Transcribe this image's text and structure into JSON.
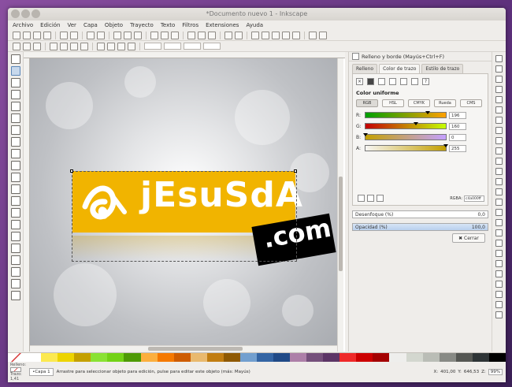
{
  "window": {
    "title": "*Documento nuevo 1 - Inkscape"
  },
  "menu": [
    "Archivo",
    "Edición",
    "Ver",
    "Capa",
    "Objeto",
    "Trayecto",
    "Texto",
    "Filtros",
    "Extensiones",
    "Ayuda"
  ],
  "canvas": {
    "logo_text": "jEsuSdA",
    "com_text": ".com"
  },
  "fill_stroke": {
    "title": "Relleno y borde (Mayús+Ctrl+F)",
    "tabs": [
      "Relleno",
      "Color de trazo",
      "Estilo de trazo"
    ],
    "active_tab": 1,
    "paint_label": "Color uniforme",
    "modes": [
      "RGB",
      "HSL",
      "CMYK",
      "Rueda",
      "CMS"
    ],
    "active_mode": 0,
    "channels": [
      {
        "label": "R:",
        "value": "196",
        "knob": 0.77,
        "gradient": "linear-gradient(90deg,#00a000,#ffa000)"
      },
      {
        "label": "G:",
        "value": "160",
        "knob": 0.63,
        "gradient": "linear-gradient(90deg,#c40000,#c4ff00)"
      },
      {
        "label": "B:",
        "value": "0",
        "knob": 0.0,
        "gradient": "linear-gradient(90deg,#c4a000,#c4a0ff)"
      },
      {
        "label": "A:",
        "value": "255",
        "knob": 1.0,
        "gradient": "linear-gradient(90deg,rgba(196,160,0,0),#c4a000)"
      }
    ],
    "rgba_label": "RGBA:",
    "rgba_value": "c4a000ff",
    "blur_label": "Desenfoque (%)",
    "blur_value": "0,0",
    "opacity_label": "Opacidad (%)",
    "opacity_value": "100,0",
    "close_label": "Cerrar"
  },
  "palette": [
    "#ffffff",
    "#fce94f",
    "#edd400",
    "#c4a000",
    "#8ae234",
    "#73d216",
    "#4e9a06",
    "#fcaf3e",
    "#f57900",
    "#ce5c00",
    "#e9b96e",
    "#c17d11",
    "#8f5902",
    "#729fcf",
    "#3465a4",
    "#204a87",
    "#ad7fa8",
    "#75507b",
    "#5c3566",
    "#ef2929",
    "#cc0000",
    "#a40000",
    "#eeeeec",
    "#d3d7cf",
    "#babdb6",
    "#888a85",
    "#555753",
    "#2e3436",
    "#000000"
  ],
  "status": {
    "fill_label": "Relleno:",
    "stroke_label": "Trazo:",
    "stroke_width": "1,41",
    "layer": "•Capa 1",
    "message": "Arrastre para seleccionar objeto para edición, pulse para editar este objeto (más: Mayús)",
    "x_label": "X:",
    "x_value": "401,00",
    "y_label": "Y:",
    "y_value": "646,53",
    "z_label": "Z:",
    "zoom": "99%"
  }
}
